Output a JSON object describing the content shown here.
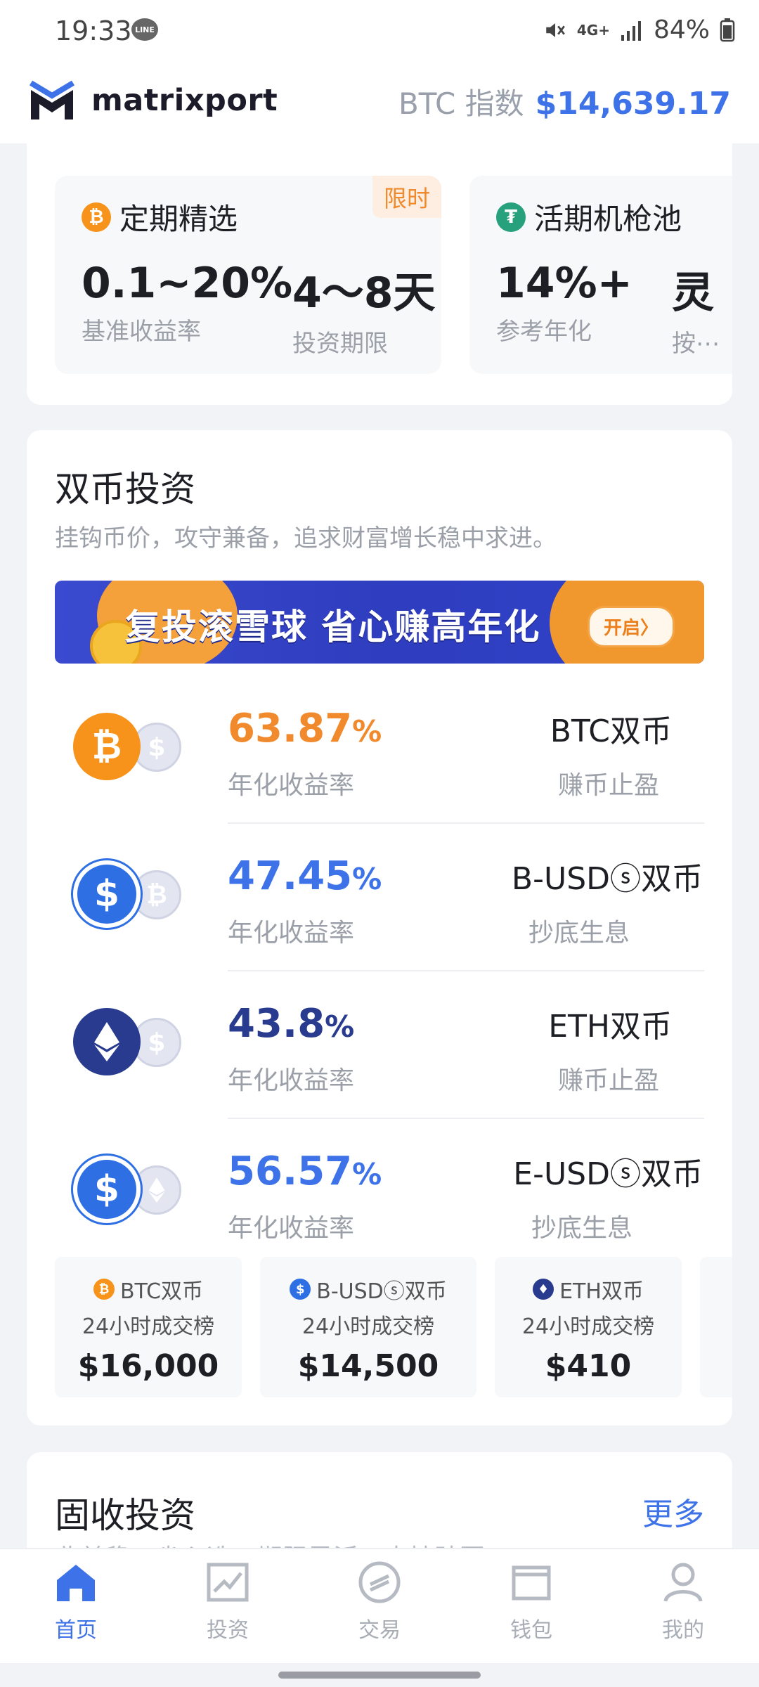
{
  "status_bar": {
    "time": "19:33",
    "line_badge": "LINE",
    "network": "4G+",
    "battery": "84%"
  },
  "header": {
    "brand": "matrixport",
    "index_label": "BTC 指数",
    "index_value": "$14,639.17"
  },
  "products": [
    {
      "coin": "bitcoin",
      "title": "定期精选",
      "badge": "限时",
      "stat1_value": "0.1~20%",
      "stat1_label": "基准收益率",
      "stat2_value": "4～8天",
      "stat2_label": "投资期限"
    },
    {
      "coin": "tether",
      "title": "活期机枪池",
      "stat1_value": "14%+",
      "stat1_label": "参考年化",
      "stat2_value": "灵",
      "stat2_label": "按⋯"
    }
  ],
  "dual": {
    "title": "双币投资",
    "subtitle": "挂钩币价，攻守兼备，追求财富增长稳中求进。",
    "banner_text": "复投滚雪球 省心赚高年化",
    "banner_button": "开启〉",
    "rows": [
      {
        "rate": "63.87",
        "pct": "%",
        "rate_label": "年化收益率",
        "name": "BTC双币",
        "desc": "赚币止盈",
        "color": "#f08a2c",
        "front": "bitcoin",
        "back": "usd"
      },
      {
        "rate": "47.45",
        "pct": "%",
        "rate_label": "年化收益率",
        "name": "B-USDⓢ双币",
        "desc": "抄底生息",
        "color": "#3d72e8",
        "front": "usdc",
        "back": "bitcoin"
      },
      {
        "rate": "43.8",
        "pct": "%",
        "rate_label": "年化收益率",
        "name": "ETH双币",
        "desc": "赚币止盈",
        "color": "#283b8f",
        "front": "ethereum",
        "back": "usd"
      },
      {
        "rate": "56.57",
        "pct": "%",
        "rate_label": "年化收益率",
        "name": "E-USDⓢ双币",
        "desc": "抄底生息",
        "color": "#3d72e8",
        "front": "usdc",
        "back": "ethereum"
      }
    ],
    "ranks": [
      {
        "name": "BTC双币",
        "label": "24小时成交榜",
        "value": "$16,000",
        "coin": "bitcoin"
      },
      {
        "name": "B-USDⓢ双币",
        "label": "24小时成交榜",
        "value": "$14,500",
        "coin": "usdc"
      },
      {
        "name": "ETH双币",
        "label": "24小时成交榜",
        "value": "$410",
        "coin": "ethereum"
      }
    ]
  },
  "fixed": {
    "title": "固收投资",
    "more": "更多",
    "subtitle": "收益稳，省心选，期限灵活，支持赎回"
  },
  "nav": [
    {
      "label": "首页",
      "icon": "home-icon",
      "active": true
    },
    {
      "label": "投资",
      "icon": "chart-icon",
      "active": false
    },
    {
      "label": "交易",
      "icon": "exchange-icon",
      "active": false
    },
    {
      "label": "钱包",
      "icon": "wallet-icon",
      "active": false
    },
    {
      "label": "我的",
      "icon": "user-icon",
      "active": false
    }
  ],
  "colors": {
    "accent": "#3d72e8",
    "orange": "#f08a2c",
    "navy": "#283b8f"
  }
}
